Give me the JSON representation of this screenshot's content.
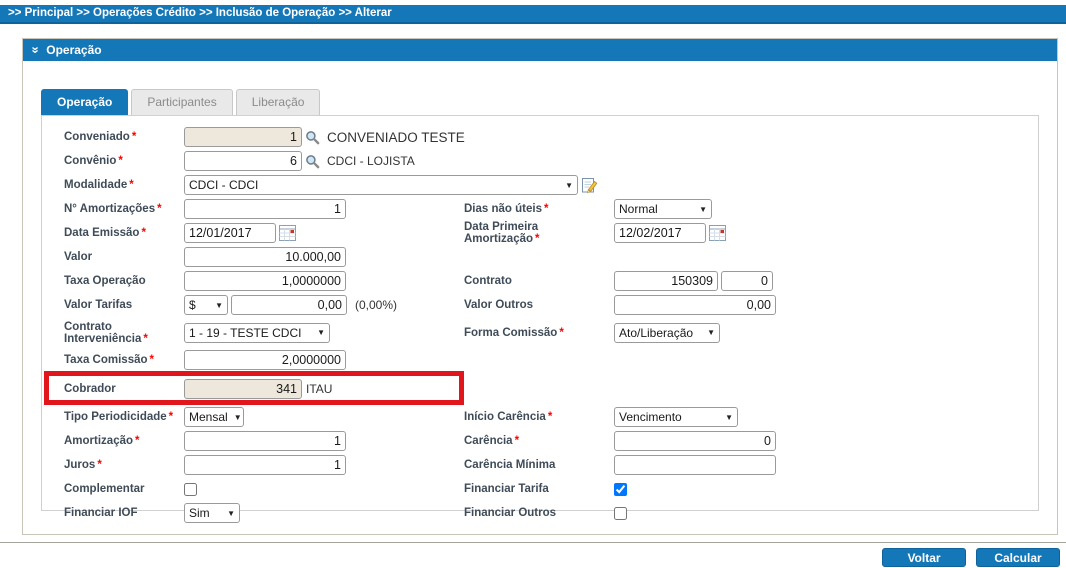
{
  "breadcrumb": {
    "text": ">> Principal >> Operações Crédito >> Inclusão de Operação >> Alterar"
  },
  "panel": {
    "title": "Operação"
  },
  "icons": {
    "chevron": "»",
    "dropdown_arrow": "▼"
  },
  "tabs": {
    "operacao": "Operação",
    "participantes": "Participantes",
    "liberacao": "Liberação"
  },
  "form": {
    "conveniado": {
      "label": "Conveniado",
      "required": "*",
      "value": "1",
      "desc": "CONVENIADO TESTE"
    },
    "convenio": {
      "label": "Convênio",
      "required": "*",
      "value": "6",
      "desc": "CDCI - LOJISTA"
    },
    "modalidade": {
      "label": "Modalidade",
      "required": "*",
      "value": "CDCI - CDCI"
    },
    "num_amortizacoes": {
      "label": "N° Amortizações",
      "required": "*",
      "value": "1"
    },
    "dias_nao_uteis": {
      "label": "Dias não úteis",
      "required": "*",
      "value": "Normal"
    },
    "data_emissao": {
      "label": "Data Emissão",
      "required": "*",
      "value": "12/01/2017"
    },
    "data_primeira_amortizacao": {
      "label": "Data Primeira Amortização",
      "required": "*",
      "value": "12/02/2017"
    },
    "valor": {
      "label": "Valor",
      "value": "10.000,00"
    },
    "taxa_operacao": {
      "label": "Taxa Operação",
      "value": "1,0000000"
    },
    "contrato": {
      "label": "Contrato",
      "value": "150309",
      "value2": "0"
    },
    "valor_tarifas": {
      "label": "Valor Tarifas",
      "unit": "$",
      "value": "0,00",
      "percent": "(0,00%)"
    },
    "valor_outros": {
      "label": "Valor Outros",
      "value": "0,00"
    },
    "contrato_interveniencia": {
      "label": "Contrato Interveniência",
      "required": "*",
      "value": "1 - 19 - TESTE CDCI"
    },
    "forma_comissao": {
      "label": "Forma Comissão",
      "required": "*",
      "value": "Ato/Liberação"
    },
    "taxa_comissao": {
      "label": "Taxa Comissão",
      "required": "*",
      "value": "2,0000000"
    },
    "cobrador": {
      "label": "Cobrador",
      "value": "341",
      "desc": "ITAU"
    },
    "tipo_periodicidade": {
      "label": "Tipo Periodicidade",
      "required": "*",
      "value": "Mensal"
    },
    "inicio_carencia": {
      "label": "Início Carência",
      "required": "*",
      "value": "Vencimento"
    },
    "amortizacao": {
      "label": "Amortização",
      "required": "*",
      "value": "1"
    },
    "carencia": {
      "label": "Carência",
      "required": "*",
      "value": "0"
    },
    "juros": {
      "label": "Juros",
      "required": "*",
      "value": "1"
    },
    "carencia_minima": {
      "label": "Carência Mínima",
      "value": ""
    },
    "complementar": {
      "label": "Complementar",
      "checked": false
    },
    "financiar_tarifa": {
      "label": "Financiar Tarifa",
      "checked": true
    },
    "financiar_iof": {
      "label": "Financiar IOF",
      "value": "Sim"
    },
    "financiar_outros": {
      "label": "Financiar Outros",
      "checked": false
    }
  },
  "buttons": {
    "voltar": "Voltar",
    "calcular": "Calcular"
  },
  "colors": {
    "accent": "#1478b8",
    "highlight": "#e0161c",
    "disabled_bg": "#ede8db",
    "required": "#ff0000"
  }
}
